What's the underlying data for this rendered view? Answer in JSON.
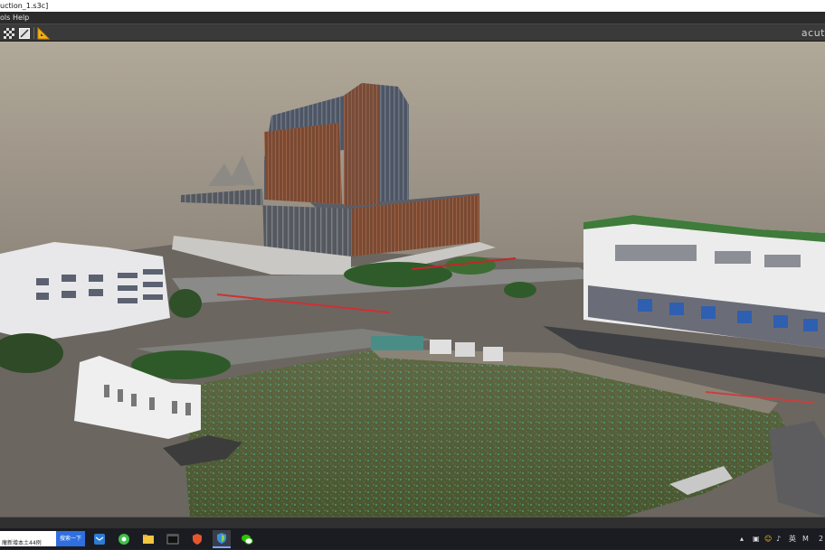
{
  "window": {
    "title_fragment": "uction_1.s3c]"
  },
  "menu": {
    "items": [
      "ols",
      "Help"
    ]
  },
  "toolbar": {
    "brand": "acut"
  },
  "taskbar": {
    "search_value": "庵新增本土44例",
    "search_button_label": "搜索一下",
    "apps": [
      "mail-app-icon",
      "browser-icon",
      "file-explorer-icon",
      "terminal-icon",
      "security-shield-icon",
      "shield-app-icon",
      "wechat-icon"
    ],
    "tray_labels": [
      "英",
      "M",
      "2"
    ]
  }
}
